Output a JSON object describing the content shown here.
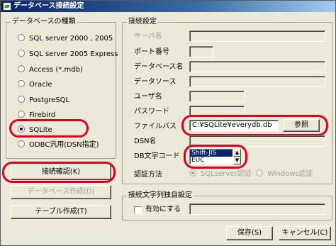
{
  "window": {
    "title": "データベース接続設定"
  },
  "db_group": {
    "legend": "データベースの種類",
    "options": [
      {
        "label": "SQL server 2000 , 2005",
        "checked": false
      },
      {
        "label": "SQL server 2005 Express",
        "checked": false
      },
      {
        "label": "Access (*.mdb)",
        "checked": false
      },
      {
        "label": "Oracle",
        "checked": false
      },
      {
        "label": "PostgreSQL",
        "checked": false
      },
      {
        "label": "Firebird",
        "checked": false
      },
      {
        "label": "SQLite",
        "checked": true
      },
      {
        "label": "ODBC汎用(DSN指定)",
        "checked": false
      }
    ]
  },
  "left_buttons": {
    "test_connection": "接続確認(K)",
    "create_db": "データベース作成(D)",
    "create_table": "テーブル作成(T)"
  },
  "connection_group": {
    "legend": "接続設定",
    "server_name_label": "サーバ名",
    "port_label": "ポート番号",
    "database_name_label": "データベース名",
    "data_source_label": "データソース",
    "user_name_label": "ユーザ名",
    "password_label": "パスワード",
    "file_path_label": "ファイルパス",
    "file_path_value": "C:¥SQLite¥everydb.db",
    "browse_button": "参照",
    "dsn_label": "DSN名",
    "charset_label": "DB文字コード",
    "charset_options": [
      "Shift-JIS",
      "EUC"
    ],
    "charset_selected": "Shift-JIS",
    "auth_label": "認証方法",
    "auth_sqlserver": "SQLserver認証",
    "auth_windows": "Windows認証"
  },
  "conn_string_group": {
    "legend": "接続文字列独自設定",
    "enable_label": "有効にする",
    "value": ""
  },
  "footer": {
    "save_button": "保存(S)",
    "cancel_button": "キャンセル(C)"
  },
  "colors": {
    "highlight_red": "#e0001b",
    "title_gradient_start": "#0a246a",
    "window_bg": "#ece9d8"
  }
}
